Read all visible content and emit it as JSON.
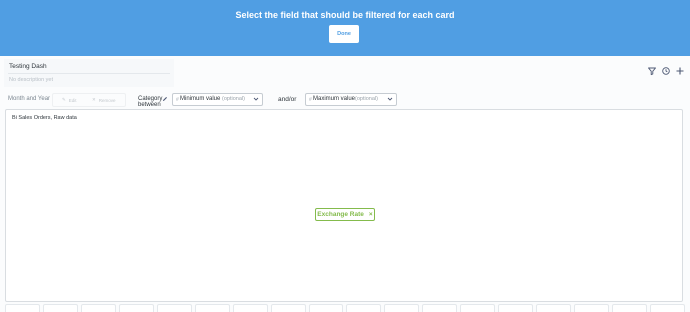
{
  "banner": {
    "title": "Select the field that should be filtered for each card",
    "done_label": "Done"
  },
  "dashboard": {
    "name": "Testing Dash",
    "description_placeholder": "No description yet",
    "icons": [
      "filter-icon",
      "history-icon",
      "add-icon"
    ]
  },
  "filters": {
    "month_year_label": "Month and Year",
    "edit_label": "Edit",
    "remove_label": "Remove",
    "category_label": "Category",
    "between_label": "between",
    "min_hash": "#",
    "min_placeholder": "Minimum value",
    "min_optional": "(optional)",
    "andor_label": "and/or",
    "max_hash": "#",
    "max_placeholder": "Maximum value",
    "max_optional": "(optional)"
  },
  "card": {
    "title": "Bi Sales Orders, Raw data",
    "field_chip_label": "Exchange Rate",
    "field_chip_remove": "×"
  },
  "colors": {
    "banner": "#509ee3",
    "chip": "#84bb4c"
  }
}
